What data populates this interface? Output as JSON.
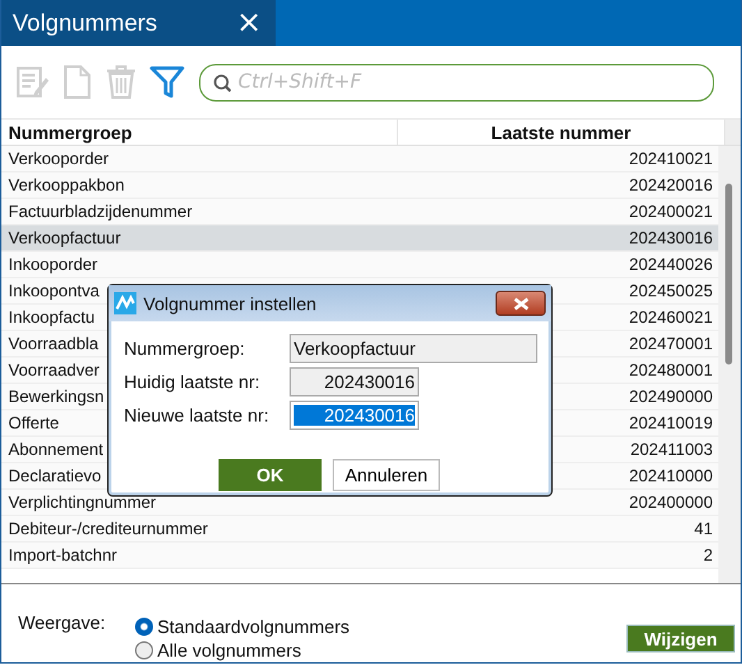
{
  "window": {
    "title": "Volgnummers",
    "close": "×"
  },
  "toolbar": [
    {
      "kind": "edit",
      "disabled": true
    },
    {
      "kind": "new",
      "disabled": true
    },
    {
      "kind": "delete",
      "disabled": true
    },
    {
      "kind": "filter",
      "disabled": false
    }
  ],
  "search": {
    "placeholder": "Ctrl+Shift+F"
  },
  "table": {
    "columns": [
      "Nummergroep",
      "Laatste nummer"
    ],
    "rows": [
      {
        "name": "Verkooporder",
        "number": "202410021",
        "selected": false
      },
      {
        "name": "Verkooppakbon",
        "number": "202420016",
        "selected": false
      },
      {
        "name": "Factuurbladzijdenummer",
        "number": "202400021",
        "selected": false
      },
      {
        "name": "Verkoopfactuur",
        "number": "202430016",
        "selected": true
      },
      {
        "name": "Inkooporder",
        "number": "202440026",
        "selected": false
      },
      {
        "name": "Inkoopontva",
        "number": "202450025",
        "selected": false
      },
      {
        "name": "Inkoopfactu",
        "number": "202460021",
        "selected": false
      },
      {
        "name": "Voorraadbla",
        "number": "202470001",
        "selected": false
      },
      {
        "name": "Voorraadver",
        "number": "202480001",
        "selected": false
      },
      {
        "name": "Bewerkingsn",
        "number": "202490000",
        "selected": false
      },
      {
        "name": "Offerte",
        "number": "202410019",
        "selected": false
      },
      {
        "name": "Abonnement",
        "number": "202411003",
        "selected": false
      },
      {
        "name": "Declaratievo",
        "number": "202410000",
        "selected": false
      },
      {
        "name": "Verplichtingnummer",
        "number": "202400000",
        "selected": false
      },
      {
        "name": "Debiteur-/crediteurnummer",
        "number": "41",
        "selected": false
      },
      {
        "name": "Import-batchnr",
        "number": "2",
        "selected": false
      }
    ]
  },
  "view": {
    "label": "Weergave:",
    "options": [
      {
        "label": "Standaardvolgnummers",
        "selected": true
      },
      {
        "label": "Alle volgnummers",
        "selected": false
      }
    ]
  },
  "change_button": "Wijzigen",
  "dialog": {
    "title": "Volgnummer instellen",
    "fields": [
      {
        "label": "Nummergroep:",
        "value": "Verkoopfactuur",
        "readonly": true,
        "highlighted": false,
        "kind": "text"
      },
      {
        "label": "Huidig laatste nr:",
        "value": "202430016",
        "readonly": true,
        "highlighted": false,
        "kind": "number"
      },
      {
        "label": "Nieuwe laatste nr:",
        "value": "202430016",
        "readonly": false,
        "highlighted": true,
        "kind": "number"
      }
    ],
    "buttons": [
      {
        "label": "OK",
        "primary": true
      },
      {
        "label": "Annuleren",
        "primary": false
      }
    ]
  }
}
